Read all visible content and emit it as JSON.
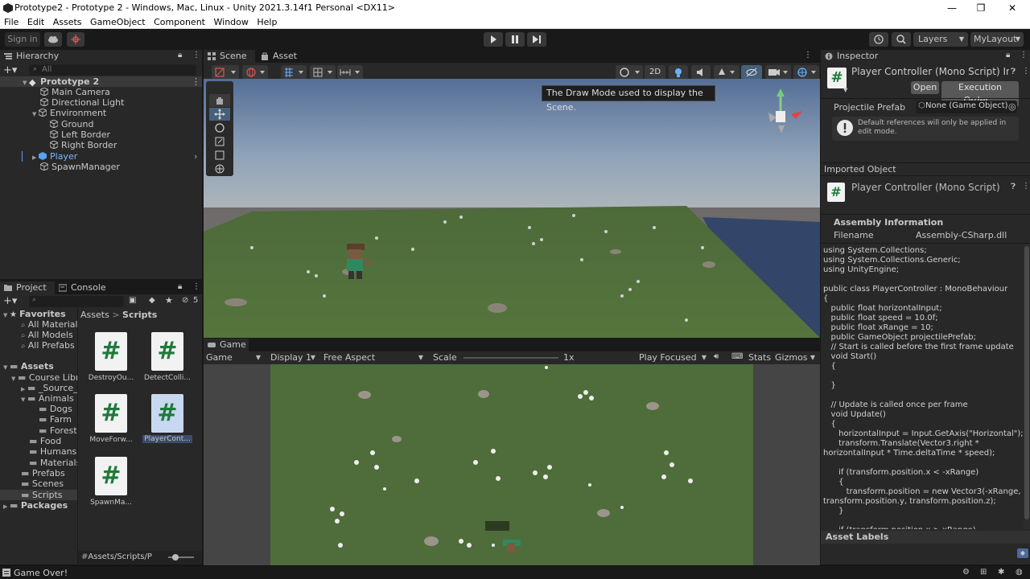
{
  "window": {
    "title": "Prototype2 - Prototype 2 - Windows, Mac, Linux - Unity 2021.3.14f1 Personal <DX11>",
    "controls": [
      "—",
      "❐",
      "✕"
    ]
  },
  "menu": [
    "File",
    "Edit",
    "Assets",
    "GameObject",
    "Component",
    "Window",
    "Help"
  ],
  "toolbar": {
    "sign_in": "Sign in",
    "layers": "Layers",
    "layout": "MyLayout"
  },
  "hierarchy": {
    "tab": "Hierarchy",
    "search_placeholder": "All",
    "items": [
      {
        "label": "Prototype 2",
        "depth": 0,
        "kind": "scene"
      },
      {
        "label": "Main Camera",
        "depth": 1,
        "kind": "obj"
      },
      {
        "label": "Directional Light",
        "depth": 1,
        "kind": "obj"
      },
      {
        "label": "Environment",
        "depth": 1,
        "kind": "obj"
      },
      {
        "label": "Ground",
        "depth": 2,
        "kind": "obj"
      },
      {
        "label": "Left Border",
        "depth": 2,
        "kind": "obj"
      },
      {
        "label": "Right Border",
        "depth": 2,
        "kind": "obj"
      },
      {
        "label": "Player",
        "depth": 1,
        "kind": "prefab"
      },
      {
        "label": "SpawnManager",
        "depth": 1,
        "kind": "obj"
      }
    ]
  },
  "project": {
    "tabs": [
      "Project",
      "Console"
    ],
    "count": "5",
    "favorites_label": "Favorites",
    "favorites": [
      "All Materials",
      "All Models",
      "All Prefabs"
    ],
    "assets_label": "Assets",
    "tree": [
      {
        "label": "Course Library",
        "depth": 1
      },
      {
        "label": "_Source_",
        "depth": 2
      },
      {
        "label": "Animals",
        "depth": 2
      },
      {
        "label": "Dogs",
        "depth": 3
      },
      {
        "label": "Farm",
        "depth": 3
      },
      {
        "label": "Forest",
        "depth": 3
      },
      {
        "label": "Food",
        "depth": 2
      },
      {
        "label": "Humans",
        "depth": 2
      },
      {
        "label": "Materials",
        "depth": 2
      },
      {
        "label": "Prefabs",
        "depth": 1
      },
      {
        "label": "Scenes",
        "depth": 1
      },
      {
        "label": "Scripts",
        "depth": 1
      }
    ],
    "packages_label": "Packages",
    "breadcrumb": [
      "Assets",
      "Scripts"
    ],
    "files": [
      "DestroyOu...",
      "DetectColli...",
      "MoveForw...",
      "PlayerCont...",
      "SpawnMa..."
    ],
    "path": "Assets/Scripts/P"
  },
  "scene": {
    "tabs": [
      "Scene",
      "Asset Store"
    ],
    "btn_2d": "2D",
    "tooltip": "The Draw Mode used to display the Scene."
  },
  "game": {
    "tab": "Game",
    "mode": "Game",
    "display": "Display 1",
    "aspect": "Free Aspect",
    "scale_label": "Scale",
    "scale_value": "1x",
    "play_focused": "Play Focused",
    "stats": "Stats",
    "gizmos": "Gizmos"
  },
  "inspector": {
    "tab": "Inspector",
    "title": "Player Controller (Mono Script) Imp",
    "open": "Open",
    "execution_order": "Execution Order...",
    "projectile_label": "Projectile Prefab",
    "projectile_value": "None (Game Object)",
    "info": "Default references will only be applied in edit mode.",
    "imported_object": "Imported Object",
    "imported_title": "Player Controller (Mono Script)",
    "assembly_info": "Assembly Information",
    "filename_label": "Filename",
    "filename_value": "Assembly-CSharp.dll",
    "code": "using System.Collections;\nusing System.Collections.Generic;\nusing UnityEngine;\n\npublic class PlayerController : MonoBehaviour\n{\n   public float horizontalInput;\n   public float speed = 10.0f;\n   public float xRange = 10;\n   public GameObject projectilePrefab;\n   // Start is called before the first frame update\n   void Start()\n   {\n\n   }\n\n   // Update is called once per frame\n   void Update()\n   {\n      horizontalInput = Input.GetAxis(\"Horizontal\");\n      transform.Translate(Vector3.right *\nhorizontalInput * Time.deltaTime * speed);\n\n      if (transform.position.x < -xRange)\n      {\n         transform.position = new Vector3(-xRange,\ntransform.position.y, transform.position.z);\n      }\n\n      if (transform.position.x > xRange)",
    "asset_labels": "Asset Labels"
  },
  "status": "Game Over!"
}
